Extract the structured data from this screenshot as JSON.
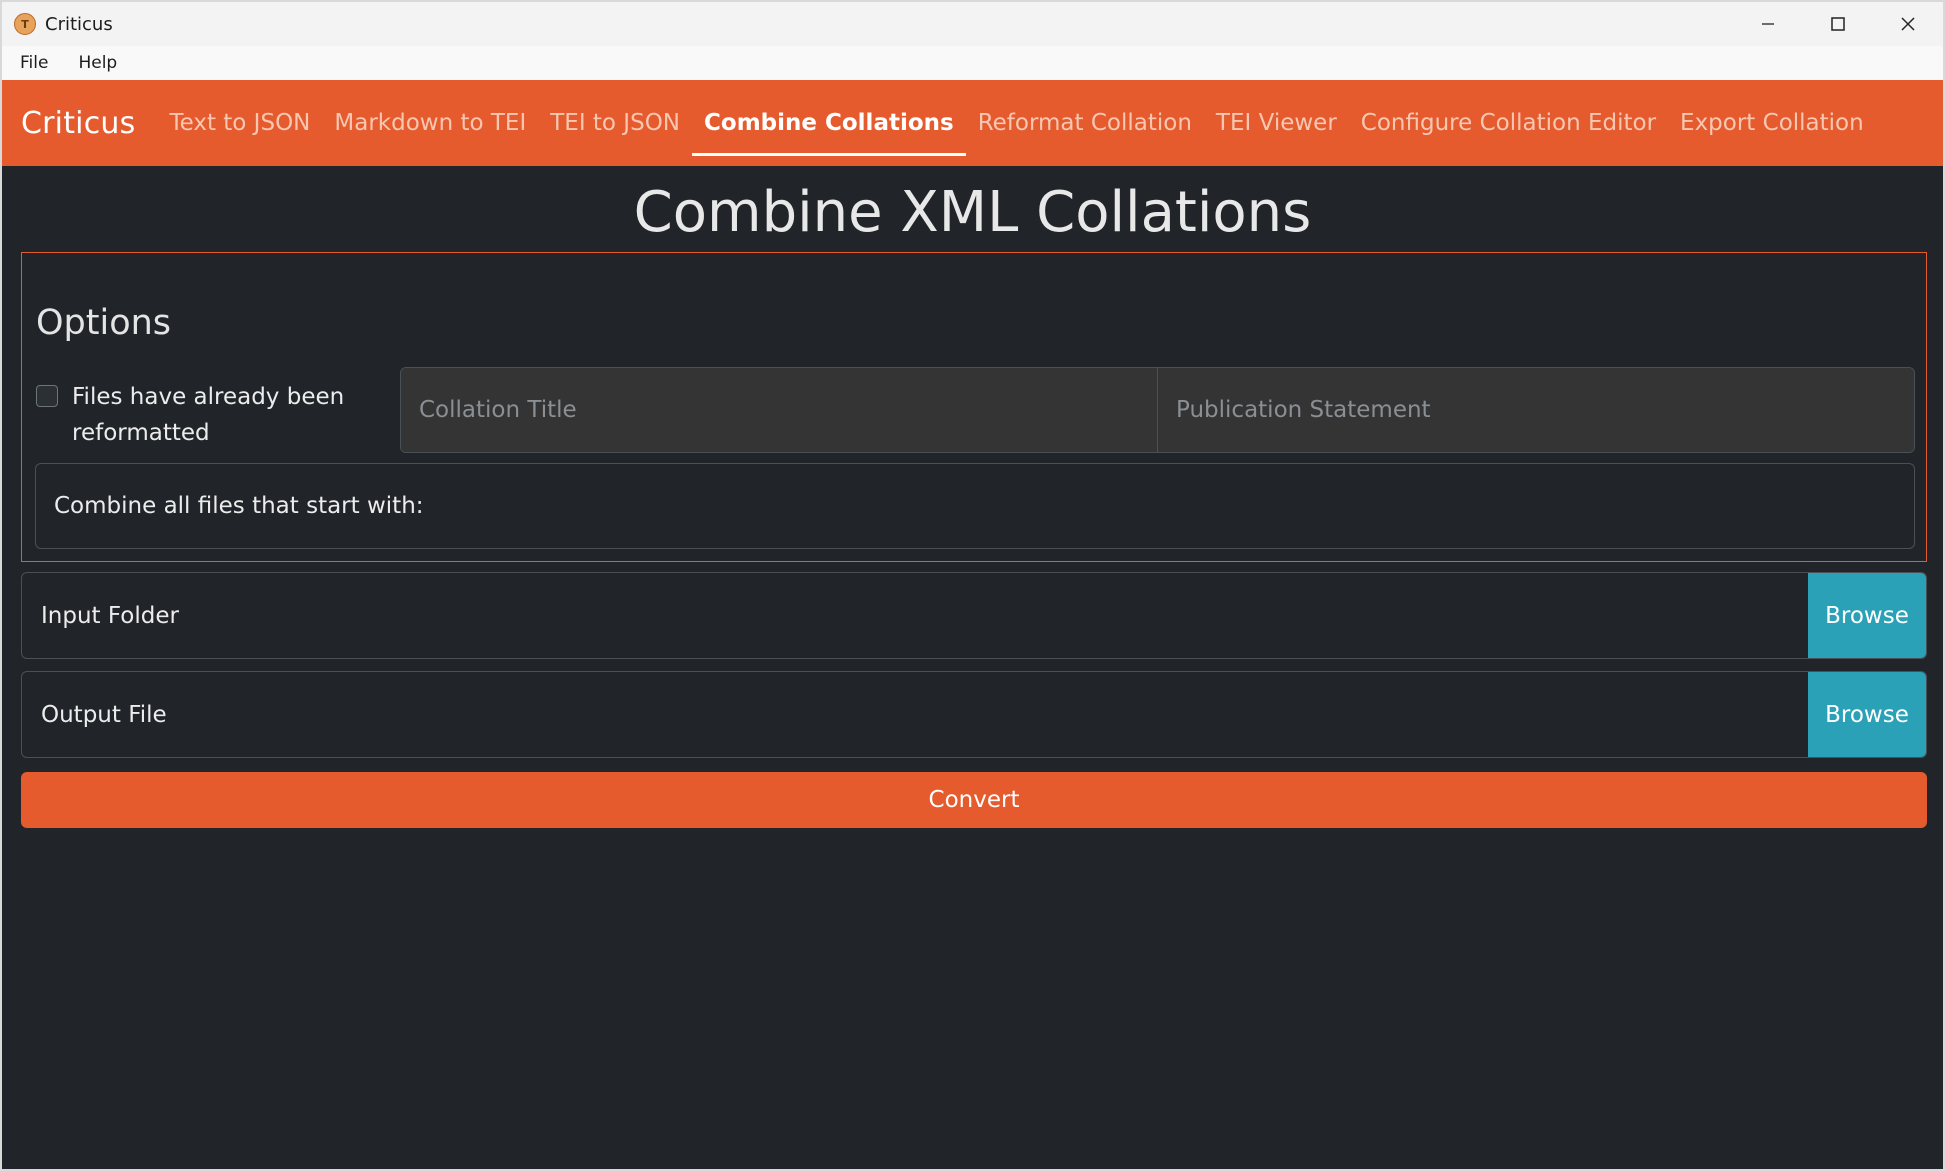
{
  "window": {
    "title": "Criticus",
    "icon": "app-icon"
  },
  "menu": {
    "items": [
      "File",
      "Help"
    ]
  },
  "navbar": {
    "brand": "Criticus",
    "links": [
      {
        "label": "Text to JSON"
      },
      {
        "label": "Markdown to TEI"
      },
      {
        "label": "TEI to JSON"
      },
      {
        "label": "Combine Collations",
        "active": true
      },
      {
        "label": "Reformat Collation"
      },
      {
        "label": "TEI Viewer"
      },
      {
        "label": "Configure Collation Editor"
      },
      {
        "label": "Export Collation"
      }
    ]
  },
  "page": {
    "title": "Combine XML Collations"
  },
  "options": {
    "heading": "Options",
    "reformatted_label": "Files have already been reformatted",
    "reformatted_checked": false,
    "collation_title_placeholder": "Collation Title",
    "publication_statement_placeholder": "Publication Statement",
    "prefix_label": "Combine all files that start with:"
  },
  "input_folder": {
    "label": "Input Folder",
    "browse_label": "Browse"
  },
  "output_file": {
    "label": "Output File",
    "browse_label": "Browse"
  },
  "convert_label": "Convert",
  "colors": {
    "accent": "#e55b2e",
    "browse": "#2ba1b8",
    "background": "#212529"
  }
}
